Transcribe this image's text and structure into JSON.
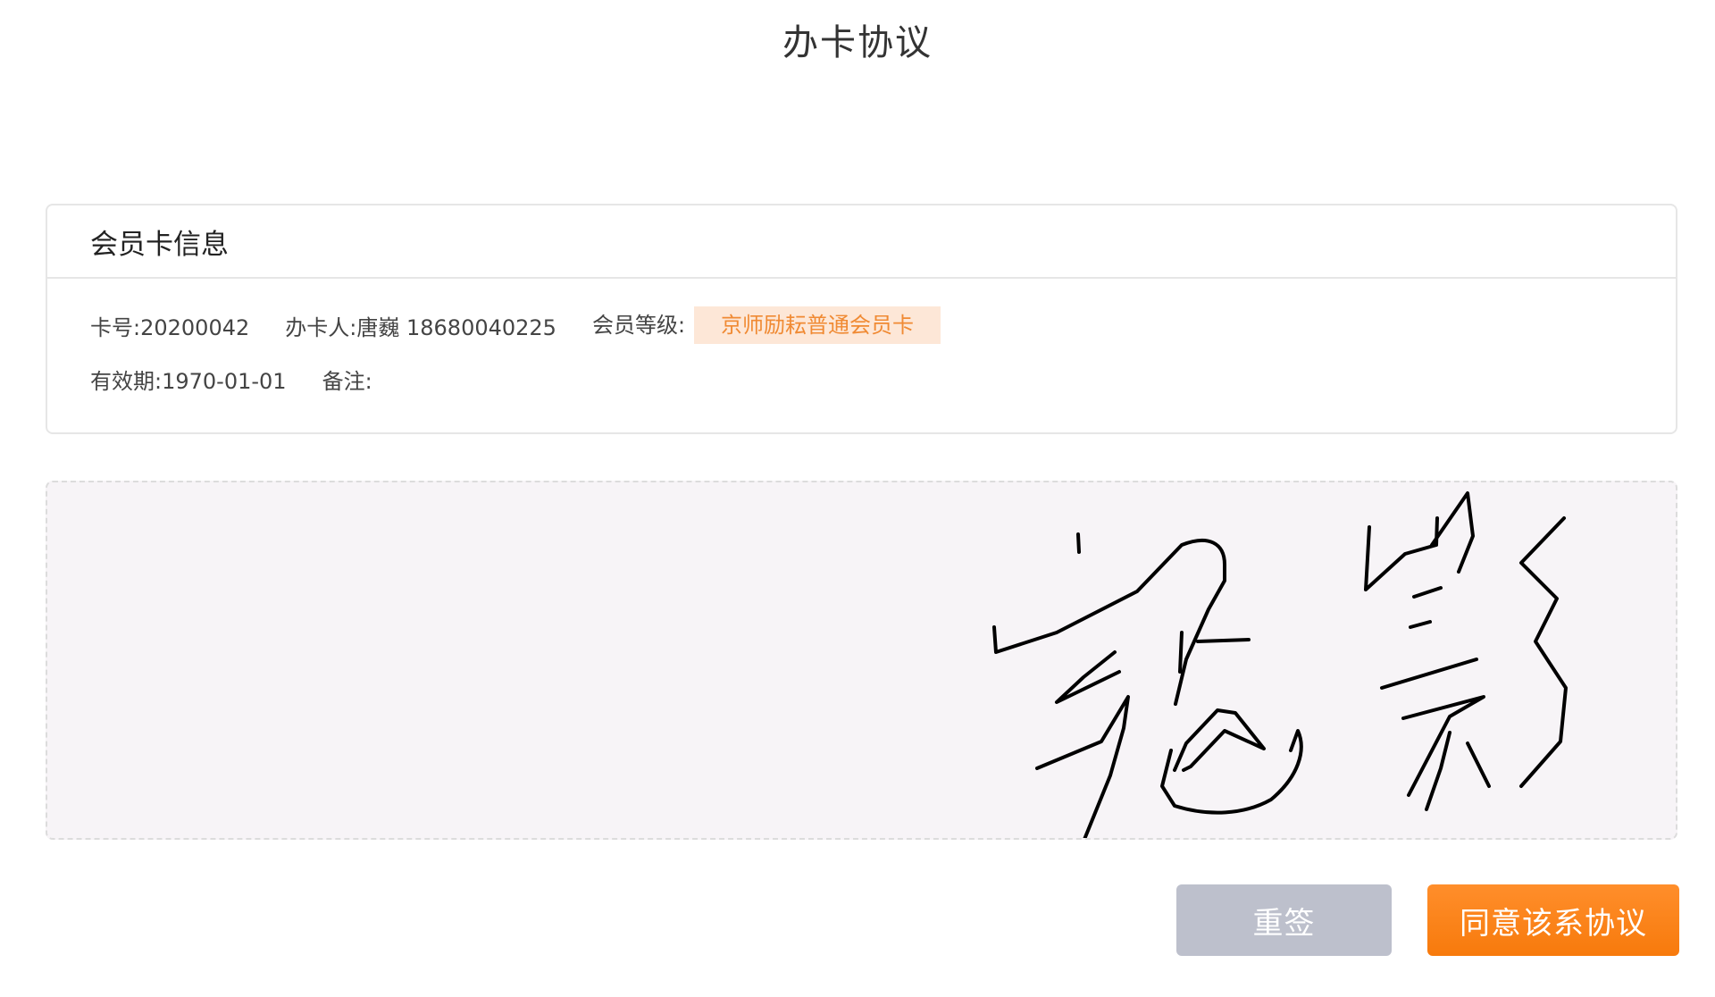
{
  "page": {
    "title": "办卡协议"
  },
  "card_info": {
    "header": "会员卡信息",
    "card_no_label": "卡号:",
    "card_no": "20200042",
    "holder_label": "办卡人:",
    "holder_name": "唐巍",
    "holder_phone": "18680040225",
    "level_label": "会员等级:",
    "level_value": "京师励耘普通会员卡",
    "validity_label": "有效期:",
    "validity_value": "1970-01-01",
    "remark_label": "备注:",
    "remark_value": ""
  },
  "actions": {
    "resign_label": "重签",
    "agree_label": "同意该系协议"
  },
  "colors": {
    "accent": "#f77a0c",
    "badge_bg": "#fde7d7",
    "badge_text": "#f08a33",
    "secondary_button": "#bdc0cc",
    "signature_bg": "#f7f4f7"
  }
}
